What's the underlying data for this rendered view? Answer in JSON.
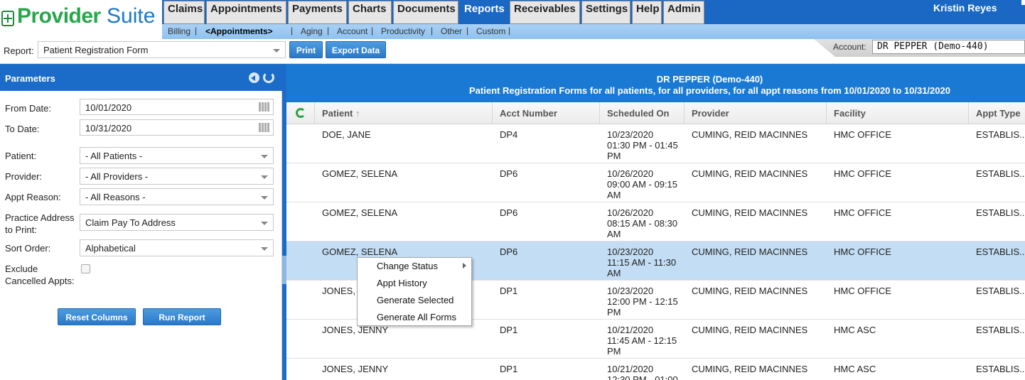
{
  "app": {
    "logo_part1": "Provider",
    "logo_part2": "Suite",
    "user": "Kristin Reyes"
  },
  "nav": {
    "tabs": [
      "Claims",
      "Appointments",
      "Payments",
      "Charts",
      "Documents",
      "Reports",
      "Receivables",
      "Settings",
      "Help",
      "Admin"
    ],
    "active_tab": "Reports",
    "subtabs": [
      "Billing",
      "<Appointments>",
      "Aging",
      "Account",
      "Productivity",
      "Other",
      "Custom"
    ],
    "separator": "|"
  },
  "toolbar": {
    "report_label": "Report:",
    "report_value": "Patient Registration Form",
    "print_label": "Print",
    "export_label": "Export Data",
    "account_label": "Account:",
    "account_value": "DR PEPPER (Demo-440)"
  },
  "parameters": {
    "title": "Parameters",
    "from_date_label": "From Date:",
    "from_date": "10/01/2020",
    "to_date_label": "To Date:",
    "to_date": "10/31/2020",
    "patient_label": "Patient:",
    "patient_value": "- All Patients -",
    "provider_label": "Provider:",
    "provider_value": "- All Providers -",
    "appt_reason_label": "Appt Reason:",
    "appt_reason_value": "- All Reasons -",
    "practice_address_label_1": "Practice Address",
    "practice_address_label_2": "to Print:",
    "practice_address_value": "Claim Pay To Address",
    "sort_order_label": "Sort Order:",
    "sort_order_value": "Alphabetical",
    "exclude_label_1": "Exclude",
    "exclude_label_2": "Cancelled Appts:",
    "exclude_checked": false,
    "reset_columns_label": "Reset Columns",
    "run_report_label": "Run Report"
  },
  "report": {
    "header_line1": "DR PEPPER (Demo-440)",
    "header_line2": "Patient Registration Forms for all patients, for all providers, for all appt reasons from 10/01/2020 to 10/31/2020",
    "columns": [
      "Patient",
      "Acct Number",
      "Scheduled On",
      "Provider",
      "Facility",
      "Appt Type"
    ],
    "sort_indicator": "↑",
    "rows": [
      {
        "patient": "DOE, JANE",
        "acct": "DP4",
        "scheduled": "10/23/2020\n01:30 PM - 01:45\nPM",
        "provider": "CUMING, REID MACINNES",
        "facility": "HMC OFFICE",
        "appt_type": "ESTABLIS..."
      },
      {
        "patient": "GOMEZ, SELENA",
        "acct": "DP6",
        "scheduled": "10/26/2020\n09:00 AM - 09:15\nAM",
        "provider": "CUMING, REID MACINNES",
        "facility": "HMC OFFICE",
        "appt_type": "ESTABLIS..."
      },
      {
        "patient": "GOMEZ, SELENA",
        "acct": "DP6",
        "scheduled": "10/26/2020\n08:15 AM - 08:30\nAM",
        "provider": "CUMING, REID MACINNES",
        "facility": "HMC OFFICE",
        "appt_type": "ESTABLIS..."
      },
      {
        "patient": "GOMEZ, SELENA",
        "acct": "DP6",
        "scheduled": "10/23/2020\n11:15 AM - 11:30\nAM",
        "provider": "CUMING, REID MACINNES",
        "facility": "HMC OFFICE",
        "appt_type": "ESTABLIS..."
      },
      {
        "patient": "JONES,",
        "acct": "DP1",
        "scheduled": "10/23/2020\n12:00 PM - 12:15\nPM",
        "provider": "CUMING, REID MACINNES",
        "facility": "HMC OFFICE",
        "appt_type": "ESTABLIS..."
      },
      {
        "patient": "JONES, JENNY",
        "acct": "DP1",
        "scheduled": "10/21/2020\n11:45 AM - 12:15\nPM",
        "provider": "CUMING, REID MACINNES",
        "facility": "HMC ASC",
        "appt_type": "ESTABLIS..."
      },
      {
        "patient": "JONES, JENNY",
        "acct": "DP1",
        "scheduled": "10/21/2020\n12:30 PM - 01:00",
        "provider": "CUMING, REID MACINNES",
        "facility": "HMC ASC",
        "appt_type": "ESTABLIS..."
      }
    ],
    "selected_row": 3
  },
  "context_menu": {
    "items": [
      "Change Status",
      "Appt History",
      "Generate Selected",
      "Generate All Forms"
    ]
  },
  "colors": {
    "primary_blue": "#1a68c4",
    "logo_green": "#27a64b",
    "selected_row": "#c3ddf4"
  }
}
